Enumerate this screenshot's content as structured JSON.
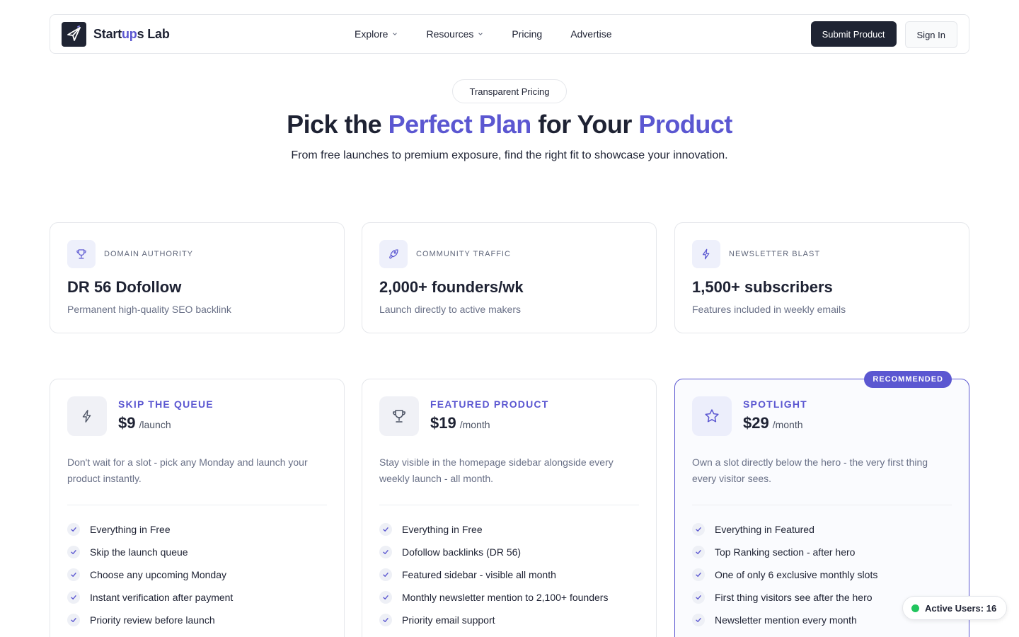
{
  "nav": {
    "logo_text_start": "Start",
    "logo_text_accent": "up",
    "logo_text_end": "s Lab",
    "links": [
      {
        "label": "Explore",
        "has_menu": true
      },
      {
        "label": "Resources",
        "has_menu": true
      },
      {
        "label": "Pricing",
        "has_menu": false
      },
      {
        "label": "Advertise",
        "has_menu": false
      }
    ],
    "submit_label": "Submit Product",
    "signin_label": "Sign In"
  },
  "hero": {
    "badge": "Transparent Pricing",
    "title_part1": "Pick the ",
    "title_highlight1": "Perfect Plan",
    "title_part2": " for Your ",
    "title_highlight2": "Product",
    "subtitle": "From free launches to premium exposure, find the right fit to showcase your innovation."
  },
  "stats": [
    {
      "icon": "trophy-icon",
      "label": "DOMAIN AUTHORITY",
      "value": "DR 56 Dofollow",
      "desc": "Permanent high-quality SEO backlink"
    },
    {
      "icon": "rocket-icon",
      "label": "COMMUNITY TRAFFIC",
      "value": "2,000+ founders/wk",
      "desc": "Launch directly to active makers"
    },
    {
      "icon": "bolt-icon",
      "label": "NEWSLETTER BLAST",
      "value": "1,500+ subscribers",
      "desc": "Features included in weekly emails"
    }
  ],
  "plans": [
    {
      "icon": "bolt-icon",
      "name": "SKIP THE QUEUE",
      "price": "$9",
      "period": "/launch",
      "desc": "Don't wait for a slot - pick any Monday and launch your product instantly.",
      "features": [
        "Everything in Free",
        "Skip the launch queue",
        "Choose any upcoming Monday",
        "Instant verification after payment",
        "Priority review before launch"
      ]
    },
    {
      "icon": "trophy-icon",
      "name": "FEATURED PRODUCT",
      "price": "$19",
      "period": "/month",
      "desc": "Stay visible in the homepage sidebar alongside every weekly launch - all month.",
      "features": [
        "Everything in Free",
        "Dofollow backlinks (DR 56)",
        "Featured sidebar - visible all month",
        "Monthly newsletter mention to 2,100+ founders",
        "Priority email support"
      ]
    },
    {
      "icon": "star-icon",
      "name": "SPOTLIGHT",
      "price": "$29",
      "period": "/month",
      "badge": "RECOMMENDED",
      "desc": "Own a slot directly below the hero - the very first thing every visitor sees.",
      "features": [
        "Everything in Featured",
        "Top Ranking section - after hero",
        "One of only 6 exclusive monthly slots",
        "First thing visitors see after the hero",
        "Newsletter mention every month"
      ]
    }
  ],
  "active_users": "Active Users: 16",
  "colors": {
    "accent": "#5b57d1",
    "dark": "#1f2433",
    "online": "#22c55e"
  }
}
